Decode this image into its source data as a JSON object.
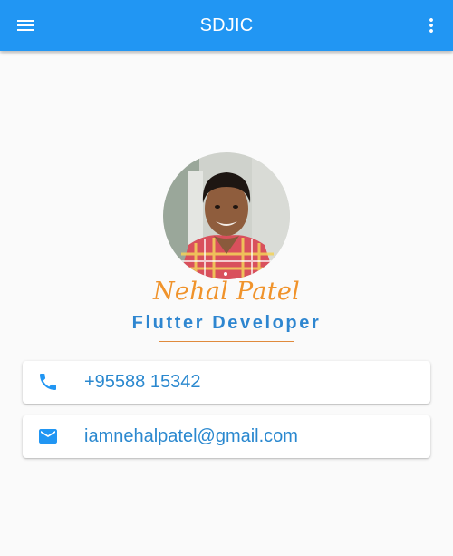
{
  "appbar": {
    "title": "SDJIC",
    "menu_icon": "menu-icon",
    "more_icon": "more-vert-icon",
    "color": "#2196f3"
  },
  "profile": {
    "name": "Nehal Patel",
    "role": "Flutter Developer",
    "name_color": "#f0932b",
    "role_color": "#2e86d0"
  },
  "contacts": [
    {
      "icon": "phone-icon",
      "value": "+95588 15342"
    },
    {
      "icon": "email-icon",
      "value": "iamnehalpatel@gmail.com"
    }
  ]
}
